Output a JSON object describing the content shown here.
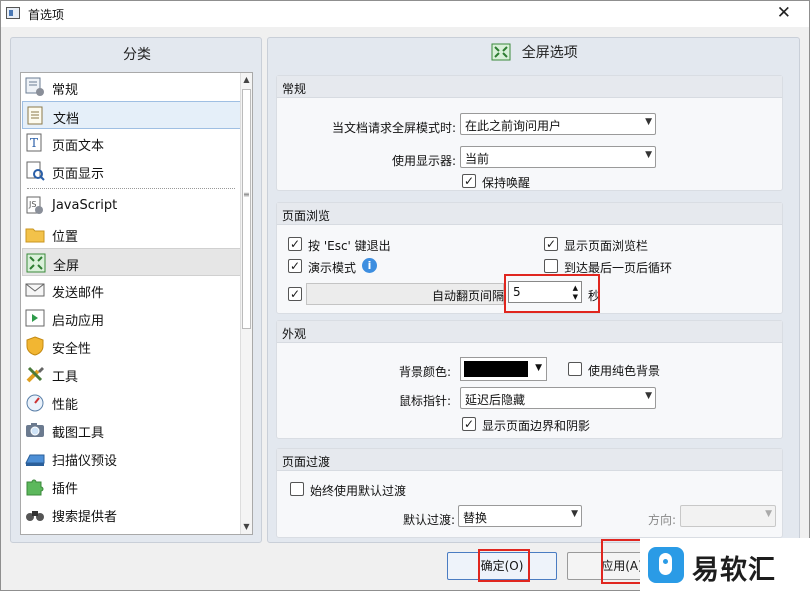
{
  "window": {
    "title": "首选项"
  },
  "sidebar": {
    "header": "分类",
    "items": [
      {
        "label": "常规",
        "icon": "general-settings-icon"
      },
      {
        "label": "文档",
        "icon": "document-icon"
      },
      {
        "label": "页面文本",
        "icon": "page-text-icon"
      },
      {
        "label": "页面显示",
        "icon": "page-display-icon"
      },
      {
        "label": "JavaScript",
        "icon": "javascript-icon"
      },
      {
        "label": "位置",
        "icon": "folder-icon"
      },
      {
        "label": "全屏",
        "icon": "fullscreen-icon"
      },
      {
        "label": "发送邮件",
        "icon": "mail-icon"
      },
      {
        "label": "启动应用",
        "icon": "launch-app-icon"
      },
      {
        "label": "安全性",
        "icon": "shield-icon"
      },
      {
        "label": "工具",
        "icon": "tools-icon"
      },
      {
        "label": "性能",
        "icon": "performance-icon"
      },
      {
        "label": "截图工具",
        "icon": "camera-icon"
      },
      {
        "label": "扫描仪预设",
        "icon": "scanner-icon"
      },
      {
        "label": "插件",
        "icon": "puzzle-icon"
      },
      {
        "label": "搜索提供者",
        "icon": "binoculars-icon"
      }
    ]
  },
  "main": {
    "title": "全屏选项",
    "general": {
      "header": "常规",
      "request_label": "当文档请求全屏模式时:",
      "request_value": "在此之前询问用户",
      "monitor_label": "使用显示器:",
      "monitor_value": "当前",
      "keep_awake_label": "保持唤醒",
      "keep_awake_checked": true
    },
    "browse": {
      "header": "页面浏览",
      "esc_label": "按 'Esc' 键退出",
      "esc_checked": true,
      "show_bar_label": "显示页面浏览栏",
      "show_bar_checked": true,
      "demo_label": "演示模式",
      "demo_checked": true,
      "loop_label": "到达最后一页后循环",
      "loop_checked": false,
      "auto_flip_label": "自动翻页间隔",
      "auto_flip_checked": true,
      "auto_flip_value": "5",
      "auto_flip_unit": "秒"
    },
    "appearance": {
      "header": "外观",
      "bg_color_label": "背景颜色:",
      "bg_color": "#000000",
      "solid_bg_label": "使用纯色背景",
      "solid_bg_checked": false,
      "pointer_label": "鼠标指针:",
      "pointer_value": "延迟后隐藏",
      "border_shadow_label": "显示页面边界和阴影",
      "border_shadow_checked": true
    },
    "transition": {
      "header": "页面过渡",
      "always_default_label": "始终使用默认过渡",
      "always_default_checked": false,
      "default_label": "默认过渡:",
      "default_value": "替换",
      "direction_label": "方向:",
      "direction_value": ""
    }
  },
  "buttons": {
    "ok": "确定(O)",
    "apply": "应用(A)"
  },
  "watermark": {
    "text": "易软汇"
  },
  "colors": {
    "highlight": "#e0261f",
    "selection": "#e5eff9",
    "panel": "#e3e8ef"
  }
}
